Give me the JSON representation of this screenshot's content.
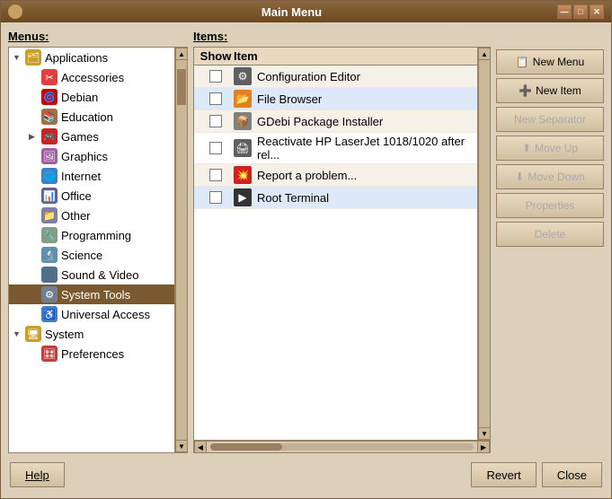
{
  "window": {
    "title": "Main Menu",
    "titlebar_icon": "●"
  },
  "titlebar_controls": {
    "minimize": "—",
    "maximize": "□",
    "close": "✕"
  },
  "left_panel": {
    "label": "Menus:",
    "items": [
      {
        "id": "applications",
        "text": "Applications",
        "indent": 0,
        "arrow": "▼",
        "icon": "apps",
        "expanded": true
      },
      {
        "id": "accessories",
        "text": "Accessories",
        "indent": 1,
        "arrow": "",
        "icon": "accessories"
      },
      {
        "id": "debian",
        "text": "Debian",
        "indent": 1,
        "arrow": "",
        "icon": "debian"
      },
      {
        "id": "education",
        "text": "Education",
        "indent": 1,
        "arrow": "",
        "icon": "education"
      },
      {
        "id": "games",
        "text": "Games",
        "indent": 1,
        "arrow": "▶",
        "icon": "games"
      },
      {
        "id": "graphics",
        "text": "Graphics",
        "indent": 1,
        "arrow": "",
        "icon": "graphics"
      },
      {
        "id": "internet",
        "text": "Internet",
        "indent": 1,
        "arrow": "",
        "icon": "internet"
      },
      {
        "id": "office",
        "text": "Office",
        "indent": 1,
        "arrow": "",
        "icon": "office"
      },
      {
        "id": "other",
        "text": "Other",
        "indent": 1,
        "arrow": "",
        "icon": "other"
      },
      {
        "id": "programming",
        "text": "Programming",
        "indent": 1,
        "arrow": "",
        "icon": "programming"
      },
      {
        "id": "science",
        "text": "Science",
        "indent": 1,
        "arrow": "",
        "icon": "science"
      },
      {
        "id": "soundvideo",
        "text": "Sound & Video",
        "indent": 1,
        "arrow": "",
        "icon": "soundvideo"
      },
      {
        "id": "systemtools",
        "text": "System Tools",
        "indent": 1,
        "arrow": "",
        "icon": "systemtools",
        "selected": true
      },
      {
        "id": "universalaccess",
        "text": "Universal Access",
        "indent": 1,
        "arrow": "",
        "icon": "universalaccess"
      },
      {
        "id": "system",
        "text": "System",
        "indent": 0,
        "arrow": "▼",
        "icon": "system"
      },
      {
        "id": "preferences",
        "text": "Preferences",
        "indent": 1,
        "arrow": "",
        "icon": "preferences"
      }
    ]
  },
  "middle_panel": {
    "label": "Items:",
    "col_show": "Show",
    "col_item": "Item",
    "rows": [
      {
        "id": "config-editor",
        "show": false,
        "icon": "⚙",
        "text": "Configuration Editor",
        "icon_color": "#606060"
      },
      {
        "id": "file-browser",
        "show": false,
        "icon": "📁",
        "text": "File Browser",
        "icon_color": "#e08020",
        "highlighted": true
      },
      {
        "id": "gdebi",
        "show": false,
        "icon": "📦",
        "text": "GDebi Package Installer",
        "icon_color": "#808080"
      },
      {
        "id": "hp-reactivate",
        "show": false,
        "icon": "🖨",
        "text": "Reactivate HP LaserJet 1018/1020 after rel...",
        "icon_color": "#606060"
      },
      {
        "id": "report-problem",
        "show": false,
        "icon": "⚠",
        "text": "Report a problem...",
        "icon_color": "#cc2222"
      },
      {
        "id": "root-terminal",
        "show": false,
        "icon": "▶",
        "text": "Root Terminal",
        "icon_color": "#333333",
        "highlighted": true
      }
    ]
  },
  "right_panel": {
    "buttons": [
      {
        "id": "new-menu",
        "label": "New Menu",
        "icon": "📋",
        "enabled": true
      },
      {
        "id": "new-item",
        "label": "New Item",
        "icon": "➕",
        "enabled": true
      },
      {
        "id": "new-separator",
        "label": "New Separator",
        "icon": "",
        "enabled": false
      },
      {
        "id": "move-up",
        "label": "Move Up",
        "icon": "⬆",
        "enabled": false
      },
      {
        "id": "move-down",
        "label": "Move Down",
        "icon": "⬇",
        "enabled": false
      },
      {
        "id": "properties",
        "label": "Properties",
        "icon": "",
        "enabled": false
      },
      {
        "id": "delete",
        "label": "Delete",
        "icon": "",
        "enabled": false
      }
    ]
  },
  "bottom_bar": {
    "help_label": "Help",
    "revert_label": "Revert",
    "close_label": "Close"
  }
}
